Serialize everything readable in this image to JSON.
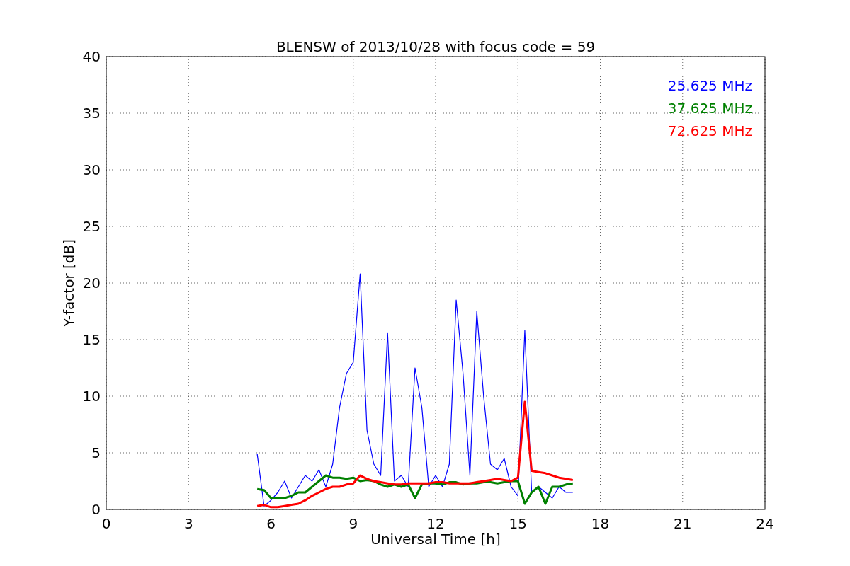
{
  "figure": {
    "chart_data": {
      "type": "line",
      "title": "BLENSW of 2013/10/28 with focus code = 59",
      "xlabel": "Universal Time [h]",
      "ylabel": "Y-factor [dB]",
      "x": [
        5.5,
        5.75,
        6,
        6.25,
        6.5,
        6.75,
        7,
        7.25,
        7.5,
        7.75,
        8,
        8.25,
        8.5,
        8.75,
        9,
        9.25,
        9.5,
        9.75,
        10,
        10.25,
        10.5,
        10.75,
        11,
        11.25,
        11.5,
        11.75,
        12,
        12.25,
        12.5,
        12.75,
        13,
        13.25,
        13.5,
        13.75,
        14,
        14.25,
        14.5,
        14.75,
        15,
        15.25,
        15.5,
        15.75,
        16,
        16.25,
        16.5,
        16.75,
        17
      ],
      "series": [
        {
          "name": "25.625 MHz",
          "color": "#0000ff",
          "values": [
            4.9,
            0.3,
            0.8,
            1.5,
            2.5,
            1,
            2,
            3,
            2.5,
            3.5,
            2,
            4,
            9,
            12,
            13,
            20.8,
            7,
            4,
            3,
            15.6,
            2.5,
            3,
            2,
            12.5,
            9,
            2,
            3,
            2,
            4,
            18.5,
            12,
            3,
            17.5,
            10,
            4,
            3.5,
            4.5,
            2,
            1.2,
            15.8,
            1.5,
            2,
            1.5,
            1,
            2,
            1.5,
            1.5
          ]
        },
        {
          "name": "37.625 MHz",
          "color": "#008000",
          "values": [
            1.8,
            1.7,
            1,
            1,
            1,
            1.2,
            1.5,
            1.5,
            2,
            2.5,
            3,
            2.8,
            2.8,
            2.7,
            2.8,
            2.5,
            2.6,
            2.5,
            2.2,
            2,
            2.2,
            2,
            2.2,
            1,
            2.2,
            2.3,
            2.3,
            2.2,
            2.4,
            2.4,
            2.2,
            2.3,
            2.3,
            2.4,
            2.4,
            2.3,
            2.4,
            2.5,
            2.5,
            0.5,
            1.5,
            2,
            0.5,
            2,
            2,
            2.2,
            2.3
          ]
        },
        {
          "name": "72.625 MHz",
          "color": "#ff0000",
          "values": [
            0.3,
            0.4,
            0.2,
            0.2,
            0.3,
            0.4,
            0.5,
            0.8,
            1.2,
            1.5,
            1.8,
            2,
            2,
            2.2,
            2.3,
            3,
            2.7,
            2.5,
            2.4,
            2.3,
            2.2,
            2.2,
            2.3,
            2.3,
            2.3,
            2.3,
            2.4,
            2.4,
            2.3,
            2.3,
            2.3,
            2.3,
            2.4,
            2.5,
            2.6,
            2.7,
            2.6,
            2.5,
            2.8,
            9.5,
            3.4,
            3.3,
            3.2,
            3,
            2.8,
            2.7,
            2.6
          ]
        }
      ],
      "xlim": [
        0,
        24
      ],
      "ylim": [
        0,
        40
      ],
      "xticks": [
        0,
        3,
        6,
        9,
        12,
        15,
        18,
        21,
        24
      ],
      "yticks": [
        0,
        5,
        10,
        15,
        20,
        25,
        30,
        35,
        40
      ],
      "grid": true
    }
  }
}
